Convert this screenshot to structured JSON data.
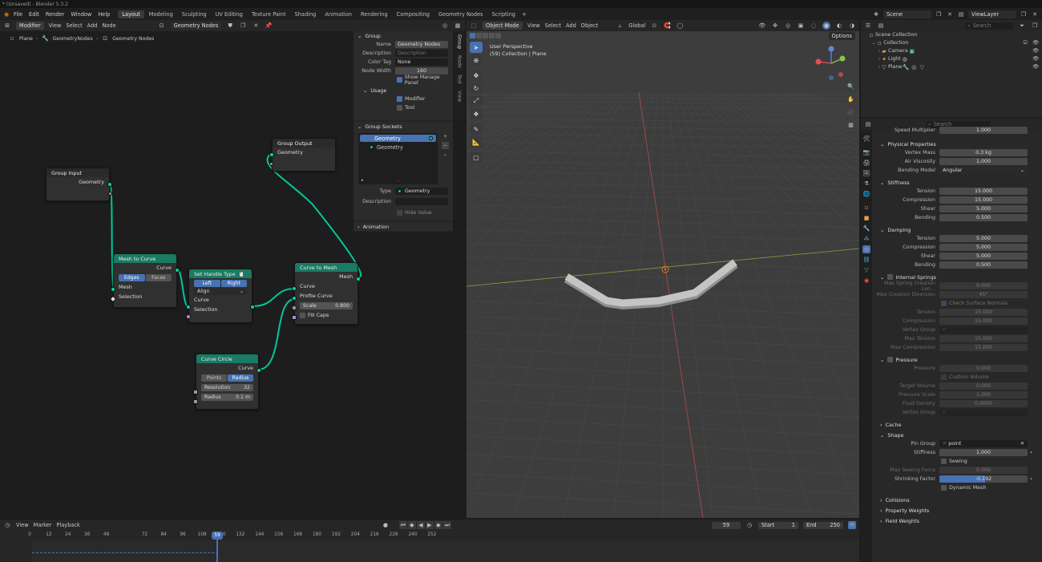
{
  "titlebar": {
    "title": "* (Unsaved) - Blender 5.3.2"
  },
  "menu": [
    "File",
    "Edit",
    "Render",
    "Window",
    "Help"
  ],
  "workspaces": [
    "Layout",
    "Modeling",
    "Sculpting",
    "UV Editing",
    "Texture Paint",
    "Shading",
    "Animation",
    "Rendering",
    "Compositing",
    "Geometry Nodes",
    "Scripting"
  ],
  "active_workspace": "Layout",
  "scene": {
    "name": "Scene",
    "view_layer": "ViewLayer"
  },
  "node_editor": {
    "mode": "Modifier",
    "menus": [
      "View",
      "Select",
      "Add",
      "Node"
    ],
    "tree_name": "Geometry Nodes",
    "breadcrumb": [
      "Plane",
      "GeometryNodes",
      "Geometry Nodes"
    ],
    "nodes": {
      "group_input": {
        "title": "Group Input",
        "out": "Geometry"
      },
      "group_output": {
        "title": "Group Output",
        "in": "Geometry"
      },
      "mesh_to_curve": {
        "title": "Mesh to Curve",
        "out": "Curve",
        "seg": [
          "Edges",
          "Faces"
        ],
        "in1": "Mesh",
        "in2": "Selection"
      },
      "set_handle": {
        "title": "Set Handle Type",
        "seg": [
          "Left",
          "Right"
        ],
        "dropdown": "Align",
        "in1": "Curve",
        "in2": "Selection"
      },
      "curve_to_mesh": {
        "title": "Curve to Mesh",
        "out": "Mesh",
        "in1": "Curve",
        "in2": "Profile Curve",
        "scale_label": "Scale",
        "scale_value": "0.800",
        "fill": "Fill Caps"
      },
      "curve_circle": {
        "title": "Curve Circle",
        "out": "Curve",
        "seg": [
          "Points",
          "Radius"
        ],
        "res_label": "Resolution",
        "res_value": "32",
        "rad_label": "Radius",
        "rad_value": "0.1 m"
      }
    },
    "sidebar": {
      "group_header": "Group",
      "name_label": "Name",
      "name_value": "Geometry Nodes",
      "desc_label": "Description",
      "desc_placeholder": "Description",
      "color_label": "Color Tag",
      "color_value": "None",
      "width_label": "Node Width",
      "width_value": "160",
      "manage_label": "Show Manage Panel",
      "usage_header": "Usage",
      "modifier_label": "Modifier",
      "tool_label": "Tool",
      "sockets_header": "Group Sockets",
      "socket1": "Geometry",
      "socket2": "Geometry",
      "type_label": "Type",
      "type_value": "Geometry",
      "desc2_label": "Description",
      "hide_label": "Hide Value",
      "anim_header": "Animation",
      "tabs": [
        "Group",
        "Node",
        "Tool",
        "View"
      ]
    }
  },
  "viewport": {
    "mode": "Object Mode",
    "menus": [
      "View",
      "Select",
      "Add",
      "Object"
    ],
    "transform": "Global",
    "options": "Options",
    "perspective": "User Perspective",
    "collection": "(59) Collection | Plane"
  },
  "outliner": {
    "search_placeholder": "Search",
    "root": "Scene Collection",
    "collection": "Collection",
    "items": [
      "Camera",
      "Light",
      "Plane"
    ]
  },
  "properties": {
    "search_placeholder": "Search",
    "top_label": "Speed Multiplier",
    "top_value": "1.000",
    "physical": {
      "header": "Physical Properties",
      "rows": [
        [
          "Vertex Mass",
          "0.3 kg"
        ],
        [
          "Air Viscosity",
          "1.000"
        ]
      ],
      "bend_label": "Bending Model",
      "bend_value": "Angular"
    },
    "stiffness": {
      "header": "Stiffness",
      "rows": [
        [
          "Tension",
          "15.000"
        ],
        [
          "Compression",
          "15.000"
        ],
        [
          "Shear",
          "5.000"
        ],
        [
          "Bending",
          "0.500"
        ]
      ]
    },
    "damping": {
      "header": "Damping",
      "rows": [
        [
          "Tension",
          "5.000"
        ],
        [
          "Compression",
          "5.000"
        ],
        [
          "Shear",
          "5.000"
        ],
        [
          "Bending",
          "0.500"
        ]
      ]
    },
    "internal": {
      "header": "Internal Springs",
      "rows": [
        [
          "Max Spring Creation Len...",
          "0.000"
        ],
        [
          "Max Creation Diversion",
          "45°"
        ]
      ],
      "check_label": "Check Surface Normals",
      "rows2": [
        [
          "Tension",
          "15.000"
        ],
        [
          "Compression",
          "15.000"
        ]
      ],
      "vg_label": "Vertex Group",
      "rows3": [
        [
          "Max Tension",
          "15.000"
        ],
        [
          "Max Compression",
          "15.000"
        ]
      ]
    },
    "pressure": {
      "header": "Pressure",
      "p_label": "Pressure",
      "p_value": "0.000",
      "custom_label": "Custom Volume",
      "rows": [
        [
          "Target Volume",
          "0.000"
        ],
        [
          "Pressure Scale",
          "1.000"
        ],
        [
          "Fluid Density",
          "0.0000"
        ]
      ],
      "vg_label": "Vertex Group"
    },
    "cache_header": "Cache",
    "shape": {
      "header": "Shape",
      "pin_label": "Pin Group",
      "pin_value": "point",
      "stiff_label": "Stiffness",
      "stiff_value": "1.000",
      "sewing_label": "Sewing",
      "max_sew_label": "Max Sewing Force",
      "max_sew_value": "0.000",
      "shrink_label": "Shrinking Factor",
      "shrink_value": "-0.192",
      "dynamic_label": "Dynamic Mesh"
    },
    "collapsed": [
      "Collisions",
      "Property Weights",
      "Field Weights"
    ]
  },
  "timeline": {
    "menus": [
      "View",
      "Marker",
      "Playback"
    ],
    "current_frame": "59",
    "start_label": "Start",
    "start_value": "1",
    "end_label": "End",
    "end_value": "250",
    "ticks": [
      "0",
      "12",
      "24",
      "36",
      "48",
      "59",
      "72",
      "84",
      "96",
      "108",
      "120",
      "132",
      "144",
      "156",
      "168",
      "180",
      "192",
      "204",
      "216",
      "228",
      "240",
      "252"
    ]
  }
}
